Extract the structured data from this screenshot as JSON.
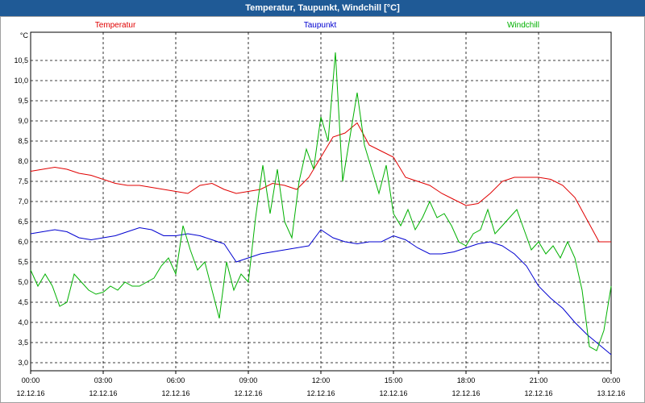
{
  "window": {
    "title": "Temperatur, Taupunkt, Windchill [°C]"
  },
  "colors": {
    "titlebar": "#1f5a96",
    "grid": "#000000",
    "axis": "#000000"
  },
  "chart_data": {
    "type": "line",
    "title": "Temperatur, Taupunkt, Windchill [°C]",
    "ylabel": "°C",
    "xlabel": "",
    "ylim": [
      2.8,
      11.2
    ],
    "xlim": [
      0,
      24
    ],
    "grid": true,
    "legend_position": "top",
    "y_ticks": [
      "3,0",
      "3,5",
      "4,0",
      "4,5",
      "5,0",
      "5,5",
      "6,0",
      "6,5",
      "7,0",
      "7,5",
      "8,0",
      "8,5",
      "9,0",
      "9,5",
      "10,0",
      "10,5"
    ],
    "y_tick_values": [
      3.0,
      3.5,
      4.0,
      4.5,
      5.0,
      5.5,
      6.0,
      6.5,
      7.0,
      7.5,
      8.0,
      8.5,
      9.0,
      9.5,
      10.0,
      10.5
    ],
    "x_ticks": [
      {
        "time": "00:00",
        "date": "12.12.16",
        "hour": 0
      },
      {
        "time": "03:00",
        "date": "12.12.16",
        "hour": 3
      },
      {
        "time": "06:00",
        "date": "12.12.16",
        "hour": 6
      },
      {
        "time": "09:00",
        "date": "12.12.16",
        "hour": 9
      },
      {
        "time": "12:00",
        "date": "12.12.16",
        "hour": 12
      },
      {
        "time": "15:00",
        "date": "12.12.16",
        "hour": 15
      },
      {
        "time": "18:00",
        "date": "12.12.16",
        "hour": 18
      },
      {
        "time": "21:00",
        "date": "12.12.16",
        "hour": 21
      },
      {
        "time": "00:00",
        "date": "13.12.16",
        "hour": 24
      }
    ],
    "series": [
      {
        "name": "Temperatur",
        "color": "#e00000",
        "x": [
          0,
          0.5,
          1,
          1.5,
          2,
          2.5,
          3,
          3.5,
          4,
          4.5,
          5,
          5.5,
          6,
          6.5,
          7,
          7.5,
          8,
          8.5,
          9,
          9.5,
          10,
          10.5,
          11,
          11.5,
          12,
          12.5,
          13,
          13.5,
          14,
          14.5,
          15,
          15.5,
          16,
          16.5,
          17,
          17.5,
          18,
          18.5,
          19,
          19.5,
          20,
          20.5,
          21,
          21.5,
          22,
          22.5,
          23,
          23.5,
          24
        ],
        "values": [
          7.75,
          7.8,
          7.85,
          7.8,
          7.7,
          7.65,
          7.55,
          7.45,
          7.4,
          7.4,
          7.35,
          7.3,
          7.25,
          7.2,
          7.4,
          7.45,
          7.3,
          7.2,
          7.25,
          7.3,
          7.45,
          7.4,
          7.3,
          7.6,
          8.1,
          8.6,
          8.7,
          8.95,
          8.4,
          8.25,
          8.1,
          7.6,
          7.5,
          7.4,
          7.2,
          7.05,
          6.9,
          6.95,
          7.2,
          7.5,
          7.6,
          7.6,
          7.6,
          7.55,
          7.4,
          7.1,
          6.55,
          6.0,
          6.0
        ]
      },
      {
        "name": "Taupunkt",
        "color": "#0000d0",
        "x": [
          0,
          0.5,
          1,
          1.5,
          2,
          2.5,
          3,
          3.5,
          4,
          4.5,
          5,
          5.5,
          6,
          6.5,
          7,
          7.5,
          8,
          8.5,
          9,
          9.5,
          10,
          10.5,
          11,
          11.5,
          12,
          12.5,
          13,
          13.5,
          14,
          14.5,
          15,
          15.5,
          16,
          16.5,
          17,
          17.5,
          18,
          18.5,
          19,
          19.5,
          20,
          20.5,
          21,
          21.5,
          22,
          22.5,
          23,
          23.5,
          24
        ],
        "values": [
          6.2,
          6.25,
          6.3,
          6.25,
          6.1,
          6.05,
          6.1,
          6.15,
          6.25,
          6.35,
          6.3,
          6.15,
          6.15,
          6.2,
          6.15,
          6.05,
          5.95,
          5.5,
          5.6,
          5.7,
          5.75,
          5.8,
          5.85,
          5.9,
          6.3,
          6.1,
          6.0,
          5.95,
          6.0,
          6.0,
          6.15,
          6.05,
          5.85,
          5.7,
          5.7,
          5.75,
          5.85,
          5.95,
          6.0,
          5.9,
          5.7,
          5.4,
          4.9,
          4.6,
          4.35,
          4.0,
          3.7,
          3.45,
          3.2
        ]
      },
      {
        "name": "Windchill",
        "color": "#00b000",
        "x": [
          0,
          0.3,
          0.6,
          0.9,
          1.2,
          1.5,
          1.8,
          2.1,
          2.4,
          2.7,
          3,
          3.3,
          3.6,
          3.9,
          4.2,
          4.5,
          4.8,
          5.1,
          5.4,
          5.7,
          6,
          6.3,
          6.6,
          6.9,
          7.2,
          7.5,
          7.8,
          8.1,
          8.4,
          8.7,
          9,
          9.3,
          9.6,
          9.9,
          10.2,
          10.5,
          10.8,
          11.1,
          11.4,
          11.7,
          12,
          12.3,
          12.6,
          12.9,
          13.2,
          13.5,
          13.8,
          14.1,
          14.4,
          14.7,
          15,
          15.3,
          15.6,
          15.9,
          16.2,
          16.5,
          16.8,
          17.1,
          17.4,
          17.7,
          18,
          18.3,
          18.6,
          18.9,
          19.2,
          19.5,
          19.8,
          20.1,
          20.4,
          20.7,
          21,
          21.3,
          21.6,
          21.9,
          22.2,
          22.5,
          22.8,
          23.1,
          23.4,
          23.7,
          24
        ],
        "values": [
          5.3,
          4.9,
          5.2,
          4.9,
          4.4,
          4.5,
          5.2,
          5.0,
          4.8,
          4.7,
          4.75,
          4.9,
          4.8,
          5.0,
          4.9,
          4.9,
          5.0,
          5.1,
          5.4,
          5.6,
          5.2,
          6.4,
          5.8,
          5.3,
          5.5,
          4.8,
          4.1,
          5.5,
          4.8,
          5.2,
          5.0,
          6.6,
          7.9,
          6.7,
          7.8,
          6.5,
          6.1,
          7.5,
          8.3,
          7.8,
          9.1,
          8.5,
          10.7,
          7.5,
          8.6,
          9.7,
          8.4,
          7.8,
          7.2,
          7.9,
          6.7,
          6.4,
          6.8,
          6.3,
          6.6,
          7.0,
          6.6,
          6.7,
          6.4,
          6.0,
          5.9,
          6.2,
          6.3,
          6.8,
          6.2,
          6.4,
          6.6,
          6.8,
          6.3,
          5.8,
          6.0,
          5.7,
          5.9,
          5.6,
          6.0,
          5.6,
          4.8,
          3.4,
          3.3,
          3.8,
          4.9
        ]
      }
    ]
  }
}
